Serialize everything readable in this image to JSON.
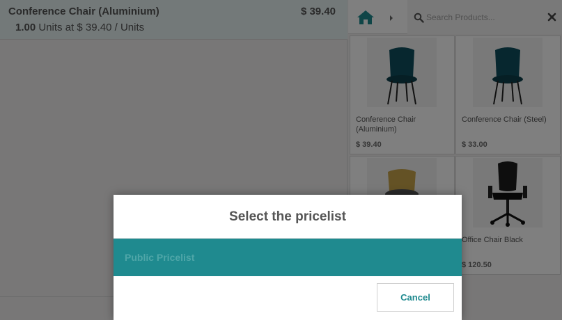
{
  "order": {
    "line": {
      "product_name": "Conference Chair (Aluminium)",
      "price": "$ 39.40",
      "quantity": "1.00",
      "unit_info": "Units at $ 39.40 / Units"
    }
  },
  "topbar": {
    "home_icon": "home-icon",
    "breadcrumb_icon": "caret-right-icon",
    "search": {
      "placeholder": "Search Products..."
    },
    "clear_icon": "close-icon"
  },
  "products": [
    {
      "name": "Conference Chair (Aluminium)",
      "price": "$ 39.40",
      "image": "teal-chair"
    },
    {
      "name": "Conference Chair (Steel)",
      "price": "$ 33.00",
      "image": "teal-chair"
    },
    {
      "name": "",
      "price": "",
      "image": "yellow-chair"
    },
    {
      "name": "Office Chair Black",
      "price": "$ 120.50",
      "image": "office-chair"
    }
  ],
  "modal": {
    "title": "Select the pricelist",
    "pricelists": [
      {
        "name": "Public Pricelist"
      }
    ],
    "cancel_label": "Cancel"
  },
  "colors": {
    "accent": "#1f8a8f",
    "orderline_bg": "#e6f2f3",
    "chair_teal": "#0f4f5e",
    "chair_yellow": "#c8a54a"
  }
}
